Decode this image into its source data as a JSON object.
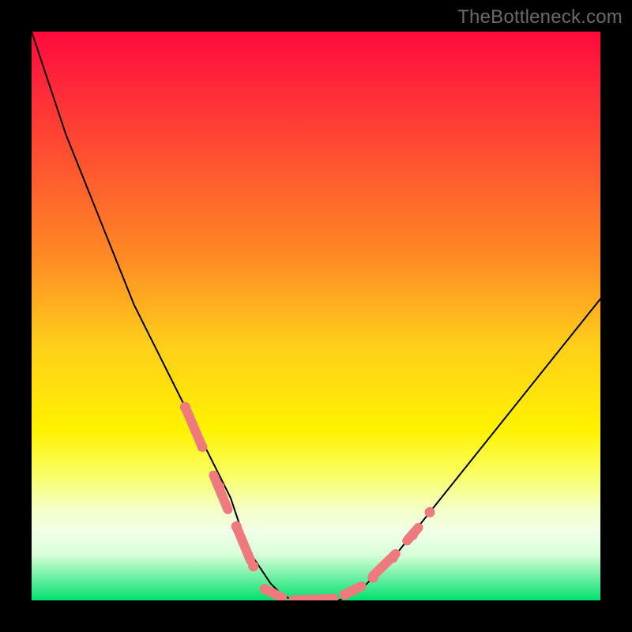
{
  "watermark": "TheBottleneck.com",
  "chart_data": {
    "type": "line",
    "title": "",
    "xlabel": "",
    "ylabel": "",
    "xlim": [
      0,
      100
    ],
    "ylim": [
      0,
      100
    ],
    "grid": false,
    "series": [
      {
        "name": "curve",
        "x": [
          0,
          2,
          4,
          6,
          8,
          10,
          12,
          14,
          16,
          18,
          20,
          22,
          24,
          26,
          28,
          30,
          32,
          33,
          34,
          35,
          36,
          37,
          38,
          40,
          42,
          44,
          46,
          48,
          50,
          52,
          54,
          56,
          58,
          60,
          62,
          64,
          66,
          68,
          70,
          72,
          74,
          76,
          78,
          80,
          82,
          84,
          86,
          88,
          90,
          92,
          94,
          96,
          98,
          100
        ],
        "y": [
          100,
          94,
          88,
          82,
          77,
          72,
          67,
          62,
          57,
          52,
          48,
          44,
          40,
          36,
          32,
          28,
          24,
          22,
          20,
          18,
          15,
          12,
          9,
          6,
          3,
          1,
          0,
          0,
          0,
          0,
          0,
          1,
          2,
          4,
          6,
          8,
          10.5,
          13,
          15.5,
          18,
          20.5,
          23,
          25.5,
          28,
          30.5,
          33,
          35.5,
          38,
          40.5,
          43,
          45.5,
          48,
          50.5,
          53
        ]
      }
    ],
    "markers": {
      "dots": [
        {
          "x": 27,
          "y": 34
        },
        {
          "x": 30,
          "y": 27
        },
        {
          "x": 33,
          "y": 20
        },
        {
          "x": 36,
          "y": 13
        },
        {
          "x": 39,
          "y": 6
        },
        {
          "x": 41,
          "y": 2
        },
        {
          "x": 44,
          "y": 0.5
        },
        {
          "x": 47,
          "y": 0
        },
        {
          "x": 50,
          "y": 0
        },
        {
          "x": 53,
          "y": 0.3
        },
        {
          "x": 55,
          "y": 1
        },
        {
          "x": 57,
          "y": 2
        },
        {
          "x": 60,
          "y": 4
        },
        {
          "x": 63.5,
          "y": 7.5
        },
        {
          "x": 67,
          "y": 11.5
        },
        {
          "x": 70,
          "y": 15.5
        }
      ],
      "segments": [
        {
          "x1": 27,
          "y1": 34,
          "x2": 30,
          "y2": 27
        },
        {
          "x1": 32,
          "y1": 22,
          "x2": 34.5,
          "y2": 16
        },
        {
          "x1": 36,
          "y1": 13,
          "x2": 38.5,
          "y2": 7
        },
        {
          "x1": 41,
          "y1": 2,
          "x2": 44,
          "y2": 0.5
        },
        {
          "x1": 46,
          "y1": 0.1,
          "x2": 53,
          "y2": 0.3
        },
        {
          "x1": 55,
          "y1": 1,
          "x2": 58,
          "y2": 2.5
        },
        {
          "x1": 60,
          "y1": 4.3,
          "x2": 64,
          "y2": 8.2
        },
        {
          "x1": 66,
          "y1": 10.5,
          "x2": 68,
          "y2": 12.8
        }
      ]
    }
  }
}
